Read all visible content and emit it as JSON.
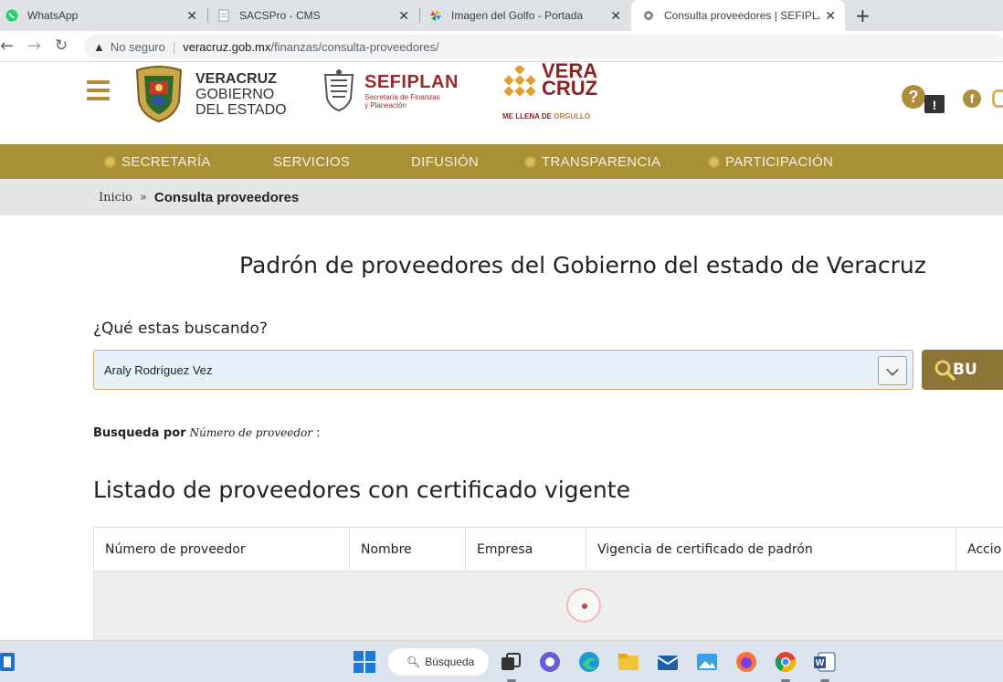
{
  "browser": {
    "tabs": [
      {
        "title": "WhatsApp",
        "icon": "whatsapp-icon",
        "active": false
      },
      {
        "title": "SACSPro - CMS",
        "icon": "document-icon",
        "active": false
      },
      {
        "title": "Imagen del Golfo - Portada",
        "icon": "pinwheel-icon",
        "active": false
      },
      {
        "title": "Consulta proveedores | SEFIPLAN",
        "icon": "gear-icon",
        "active": true
      }
    ],
    "address": {
      "security_label": "No seguro",
      "host": "veracruz.gob.mx",
      "path": "/finanzas/consulta-proveedores/"
    }
  },
  "header": {
    "gob_logo": {
      "line1": "VERACRUZ",
      "line2": "GOBIERNO",
      "line3": "DEL ESTADO"
    },
    "sefiplan_logo": {
      "name": "SEFIPLAN",
      "line1": "Secretaría de Finanzas",
      "line2": "y Planeación"
    },
    "veracruz_logo": {
      "line1": "VERA",
      "line2": "CRUZ",
      "slogan_a": "ME LLENA DE",
      "slogan_b": "ORGULLO"
    }
  },
  "nav": {
    "items": [
      {
        "label": "SECRETARÍA",
        "dot": true
      },
      {
        "label": "SERVICIOS",
        "dot": false
      },
      {
        "label": "DIFUSIÓN",
        "dot": false
      },
      {
        "label": "TRANSPARENCIA",
        "dot": true
      },
      {
        "label": "PARTICIPACIÓN",
        "dot": true
      }
    ]
  },
  "breadcrumb": {
    "home": "Inicio",
    "separator": "»",
    "current": "Consulta proveedores"
  },
  "main": {
    "title": "Padrón de proveedores del Gobierno del estado de Veracruz",
    "search_label": "¿Qué estas buscando?",
    "search_value": "Araly Rodríguez Vez",
    "search_button": "BU",
    "search_by_label": "Busqueda por",
    "search_by_field": "Número de proveedor",
    "search_by_suffix": ":",
    "list_title": "Listado de proveedores con certificado vigente",
    "table_headers": [
      "Número de proveedor",
      "Nombre",
      "Empresa",
      "Vigencia de certificado de padrón",
      "Accio"
    ]
  },
  "taskbar": {
    "search_label": "Búsqueda"
  },
  "colors": {
    "gold": "#a99035",
    "button": "#8c7437",
    "brand_red": "#9b2a2a"
  }
}
